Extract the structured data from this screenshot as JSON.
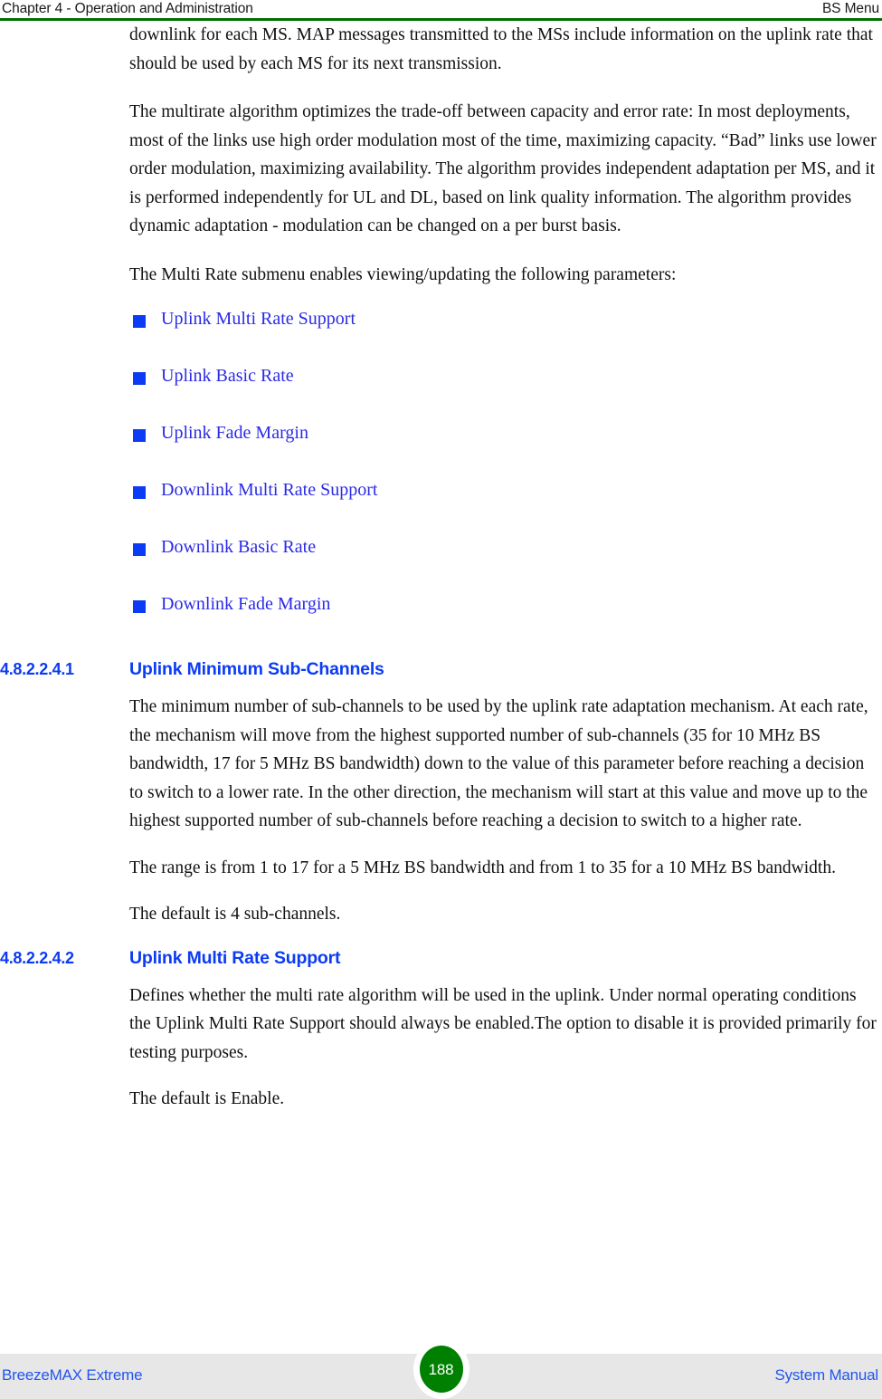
{
  "header": {
    "left_title": "Chapter 4 - Operation and Administration",
    "right_title": "BS Menu",
    "rule_color": "#007000"
  },
  "colors": {
    "heading_blue": "#0B3BF5",
    "link_blue": "#2A2AE8",
    "bullet_blue": "#0B3BF5",
    "footer_link_blue": "#2255EE",
    "badge_green": "#008000",
    "footer_band": "#E7E7E7"
  },
  "body": {
    "paragraphs_intro": [
      "downlink for each MS. MAP messages transmitted to the MSs include information on the uplink rate that should be used by each MS for its next transmission.",
      "The multirate algorithm optimizes the trade-off between capacity and error rate: In most deployments, most of the links use high order modulation most of the time, maximizing capacity. “Bad” links use lower order modulation, maximizing availability. The algorithm provides independent adaptation per MS, and it is performed independently for UL and DL, based on link quality information. The algorithm provides dynamic adaptation - modulation can be changed on a per burst basis.",
      "The Multi Rate submenu enables viewing/updating the following parameters:"
    ],
    "bullet_items": [
      "Uplink Multi Rate Support",
      "Uplink Basic Rate",
      "Uplink Fade Margin",
      "Downlink Multi Rate Support",
      "Downlink Basic Rate",
      "Downlink Fade Margin"
    ],
    "sections": [
      {
        "number": "4.8.2.2.4.1",
        "title": "Uplink Minimum Sub-Channels",
        "paragraphs": [
          "The minimum number of sub-channels to be used by the uplink rate adaptation mechanism. At each rate, the mechanism will move from the highest supported number of sub-channels (35 for 10 MHz BS bandwidth, 17 for 5 MHz BS bandwidth) down to the value of this parameter before reaching a decision to switch to a lower rate. In the other direction, the mechanism will start at this value and move up to the highest supported number of sub-channels before reaching a decision to switch to a higher rate.",
          "The range is from 1 to 17 for a 5 MHz BS bandwidth and from 1 to 35 for a 10 MHz BS bandwidth.",
          "The default is 4 sub-channels."
        ]
      },
      {
        "number": "4.8.2.2.4.2",
        "title": "Uplink Multi Rate Support",
        "paragraphs": [
          "Defines whether the multi rate algorithm will be used in the uplink. Under normal operating conditions the Uplink Multi Rate Support should always be enabled.The option to disable it is provided primarily for testing purposes.",
          "The default is Enable."
        ]
      }
    ]
  },
  "footer": {
    "left_text": "BreezeMAX Extreme",
    "page_number": "188",
    "right_text": "System Manual"
  }
}
